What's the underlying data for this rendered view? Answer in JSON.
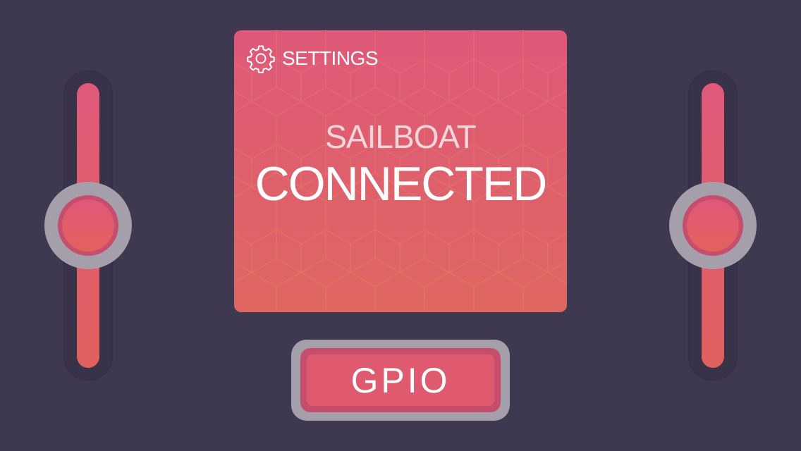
{
  "colors": {
    "background": "#3e3850",
    "accent": "#df5a7a",
    "knob_outer": "#a59eab",
    "knob_ring": "#c44e6c"
  },
  "left_slider": {
    "level": 0.5
  },
  "right_slider": {
    "level": 0.5
  },
  "status_panel": {
    "settings_icon": "gear-icon",
    "settings_label": "SETTINGS",
    "device_name": "SAILBOAT",
    "connection_status": "CONNECTED"
  },
  "gpio_button": {
    "label": "GPIO"
  }
}
